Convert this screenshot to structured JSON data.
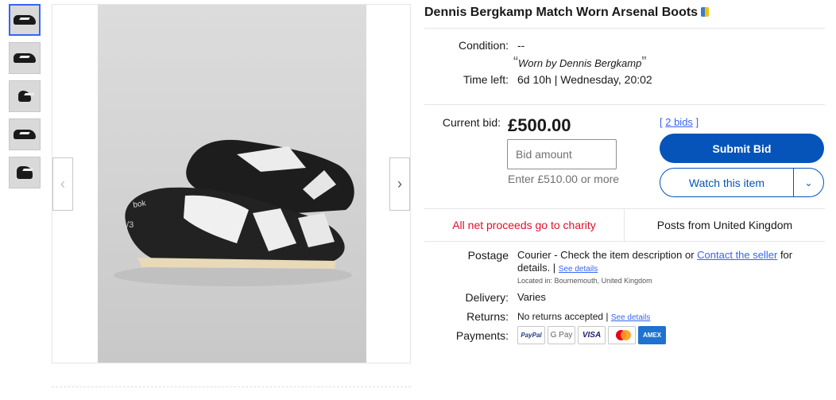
{
  "listing": {
    "title": "Dennis Bergkamp Match Worn Arsenal Boots"
  },
  "gallery": {
    "thumbnail_count": 5,
    "active_index": 0,
    "prev_icon": "chevron-left-icon",
    "next_icon": "chevron-right-icon",
    "prev_glyph": "‹",
    "next_glyph": "›"
  },
  "details": {
    "condition_label": "Condition:",
    "condition_value": "--",
    "condition_quote": "Worn by Dennis Bergkamp",
    "open_quote": "“",
    "close_quote": "”",
    "time_left_label": "Time left:",
    "time_left_value": "6d 10h",
    "separator": "|",
    "end_time": "Wednesday, 20:02"
  },
  "bid": {
    "current_label": "Current bid:",
    "current_price": "£500.00",
    "input_placeholder": "Bid amount",
    "hint": "Enter £510.00 or more",
    "bids_prefix": "[ ",
    "bids_link": "2 bids",
    "bids_suffix": " ]",
    "submit_label": "Submit Bid",
    "watch_label": "Watch this item",
    "watch_arrow": "⌄"
  },
  "info": {
    "charity": "All net proceeds go to charity",
    "posts_from": "Posts from United Kingdom"
  },
  "shipping": {
    "postage_label": "Postage",
    "postage_text": "Courier - Check the item description or ",
    "postage_link": "Contact the seller",
    "postage_text2": " for details. | ",
    "see_details": "See details",
    "located": "Located in: Bournemouth, United Kingdom",
    "delivery_label": "Delivery:",
    "delivery_value": "Varies",
    "returns_label": "Returns:",
    "returns_value": "No returns accepted | ",
    "returns_link": "See details",
    "payments_label": "Payments:",
    "payments": [
      {
        "name": "PayPal",
        "icon": "paypal-icon"
      },
      {
        "name": "G Pay",
        "icon": "google-pay-icon"
      },
      {
        "name": "VISA",
        "icon": "visa-icon"
      },
      {
        "name": "Mastercard",
        "icon": "mastercard-icon"
      },
      {
        "name": "AMEX",
        "icon": "amex-icon"
      }
    ]
  },
  "colors": {
    "primary_button": "#0654ba",
    "link": "#3665f3",
    "charity_red": "#e0102a"
  }
}
